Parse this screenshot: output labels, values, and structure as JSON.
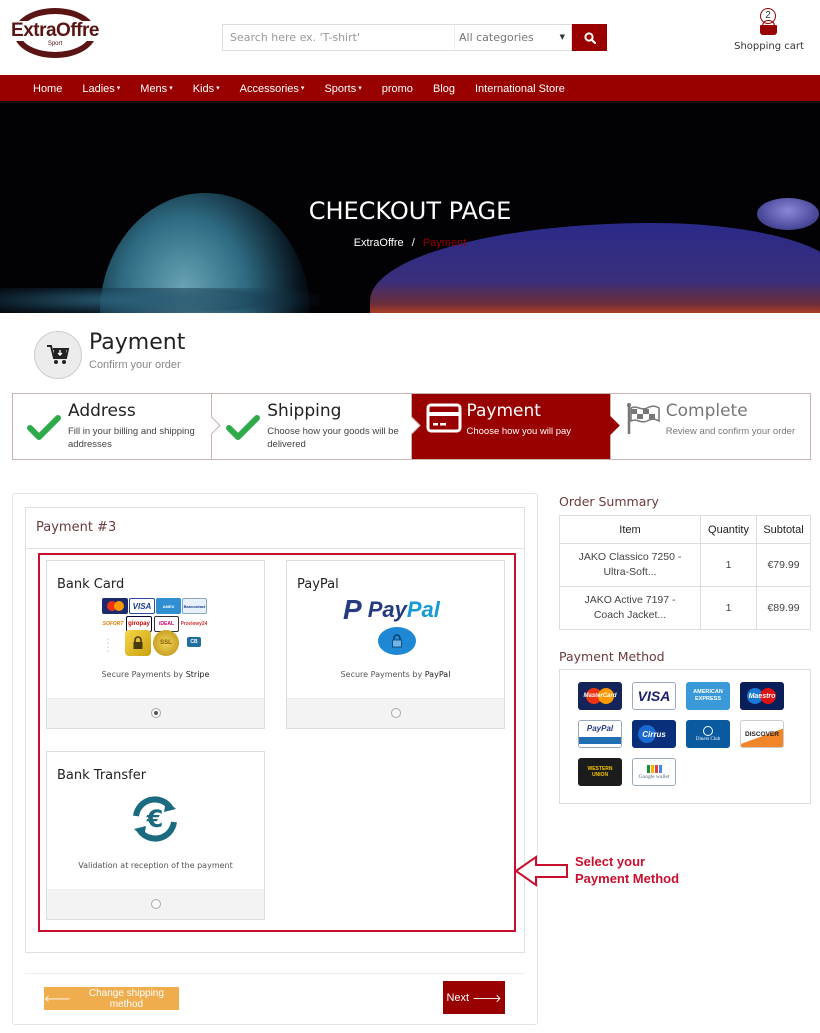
{
  "header": {
    "logo_text": "ExtraOffre",
    "logo_sub": "Sport",
    "search_placeholder": "Search here ex. 'T-shirt'",
    "category_selected": "All categories",
    "cart_count": "2",
    "cart_label": "Shopping cart"
  },
  "nav": {
    "items": [
      {
        "label": "Home",
        "dropdown": false
      },
      {
        "label": "Ladies",
        "dropdown": true
      },
      {
        "label": "Mens",
        "dropdown": true
      },
      {
        "label": "Kids",
        "dropdown": true
      },
      {
        "label": "Accessories",
        "dropdown": true
      },
      {
        "label": "Sports",
        "dropdown": true
      },
      {
        "label": "promo",
        "dropdown": false
      },
      {
        "label": "Blog",
        "dropdown": false
      },
      {
        "label": "International Store",
        "dropdown": false
      }
    ]
  },
  "hero": {
    "title": "CHECKOUT PAGE",
    "breadcrumb_home": "ExtraOffre",
    "breadcrumb_sep": "/",
    "breadcrumb_current": "Payment"
  },
  "page": {
    "title": "Payment",
    "subtitle": "Confirm your order"
  },
  "steps": [
    {
      "title": "Address",
      "desc": "Fill in your billing and shipping addresses",
      "state": "done",
      "icon": "check-icon"
    },
    {
      "title": "Shipping",
      "desc": "Choose how your goods will be delivered",
      "state": "done",
      "icon": "check-icon"
    },
    {
      "title": "Payment",
      "desc": "Choose how you will pay",
      "state": "active",
      "icon": "credit-card-icon"
    },
    {
      "title": "Complete",
      "desc": "Review and confirm your order",
      "state": "pending",
      "icon": "checkered-flag-icon"
    }
  ],
  "payment_panel": {
    "title": "Payment #3",
    "options": [
      {
        "name": "Bank Card",
        "caption_prefix": "Secure Payments by",
        "caption_brand": "Stripe",
        "selected": true,
        "logos": [
          "MasterCard",
          "VISA",
          "American Express",
          "Bancontact",
          "SOFORT",
          "giropay",
          "iDEAL",
          "Przelewy24",
          "Secure lock",
          "SSL",
          "CB"
        ]
      },
      {
        "name": "PayPal",
        "caption_prefix": "Secure Payments by",
        "caption_brand": "PayPal",
        "selected": false,
        "logos": [
          "PayPal",
          "Secure lock"
        ]
      },
      {
        "name": "Bank Transfer",
        "caption_prefix": "Validation at reception of the payment",
        "caption_brand": "",
        "selected": false,
        "logos": [
          "Euro transfer"
        ]
      }
    ],
    "annotation": "Select your Payment Method",
    "annotation_line1": "Select your",
    "annotation_line2": "Payment Method",
    "back_button": "Change shipping method",
    "next_button": "Next"
  },
  "order_summary": {
    "title": "Order Summary",
    "columns": [
      "Item",
      "Quantity",
      "Subtotal"
    ],
    "rows": [
      {
        "item_line1": "JAKO Classico 7250 -",
        "item_line2": "Ultra-Soft...",
        "quantity": "1",
        "subtotal": "€79.99"
      },
      {
        "item_line1": "JAKO Active 7197 -",
        "item_line2": "Coach Jacket...",
        "quantity": "1",
        "subtotal": "€89.99"
      }
    ]
  },
  "payment_methods": {
    "title": "Payment Method",
    "cards": [
      "MasterCard",
      "VISA",
      "AMERICAN EXPRESS",
      "Maestro",
      "PayPal",
      "Cirrus",
      "Diners Club",
      "DISCOVER",
      "WESTERN UNION",
      "Google wallet"
    ]
  },
  "colors": {
    "brand": "#990000",
    "annotation": "#c8102e",
    "back_button": "#f0ad4e",
    "check": "#2eaa4a"
  }
}
